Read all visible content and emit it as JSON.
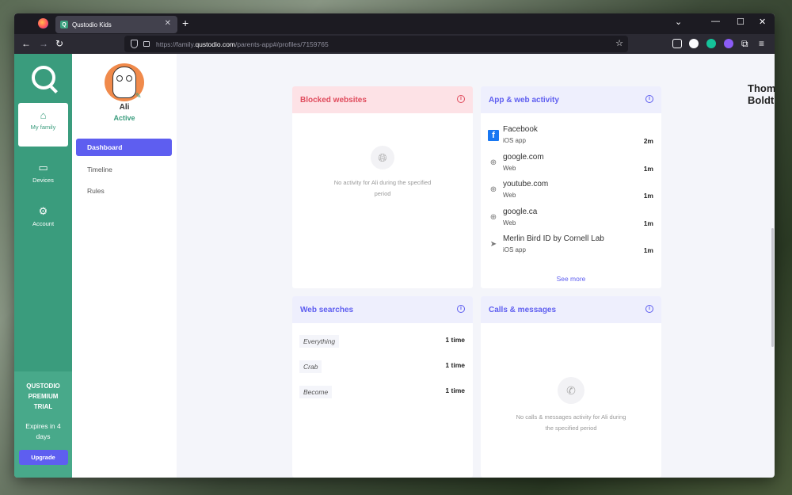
{
  "browser": {
    "tab_title": "Qustodio Kids",
    "url_prefix": "https://family.",
    "url_host": "qustodio.com",
    "url_path": "/parents-app#/profiles/7159765"
  },
  "leftnav": {
    "items": [
      {
        "label": "My family",
        "icon": "home-icon"
      },
      {
        "label": "Devices",
        "icon": "devices-icon"
      },
      {
        "label": "Account",
        "icon": "gear-icon"
      }
    ],
    "premium_title": "QUSTODIO PREMIUM TRIAL",
    "expires": "Expires in 4 days",
    "upgrade": "Upgrade"
  },
  "profile": {
    "name": "Ali",
    "status": "Active",
    "menu": [
      "Dashboard",
      "Timeline",
      "Rules"
    ]
  },
  "header": {
    "user_name": "Thomas Boldt"
  },
  "cards": {
    "blocked": {
      "title": "Blocked websites",
      "empty_line1": "No activity for Ali during the specified",
      "empty_line2": "period"
    },
    "activity": {
      "title": "App & web activity",
      "items": [
        {
          "name": "Facebook",
          "type": "iOS app",
          "time": "2m",
          "icon": "facebook-icon"
        },
        {
          "name": "google.com",
          "type": "Web",
          "time": "1m",
          "icon": "globe-icon"
        },
        {
          "name": "youtube.com",
          "type": "Web",
          "time": "1m",
          "icon": "globe-icon"
        },
        {
          "name": "google.ca",
          "type": "Web",
          "time": "1m",
          "icon": "globe-icon"
        },
        {
          "name": "Merlin Bird ID by Cornell Lab",
          "type": "iOS app",
          "time": "1m",
          "icon": "bird-icon"
        }
      ],
      "see_more": "See more"
    },
    "searches": {
      "title": "Web searches",
      "items": [
        {
          "term": "Everything",
          "count": "1 time"
        },
        {
          "term": "Crab",
          "count": "1 time"
        },
        {
          "term": "Become",
          "count": "1 time"
        }
      ]
    },
    "calls": {
      "title": "Calls & messages",
      "empty_line1": "No calls & messages activity for Ali during",
      "empty_line2": "the specified period"
    }
  }
}
